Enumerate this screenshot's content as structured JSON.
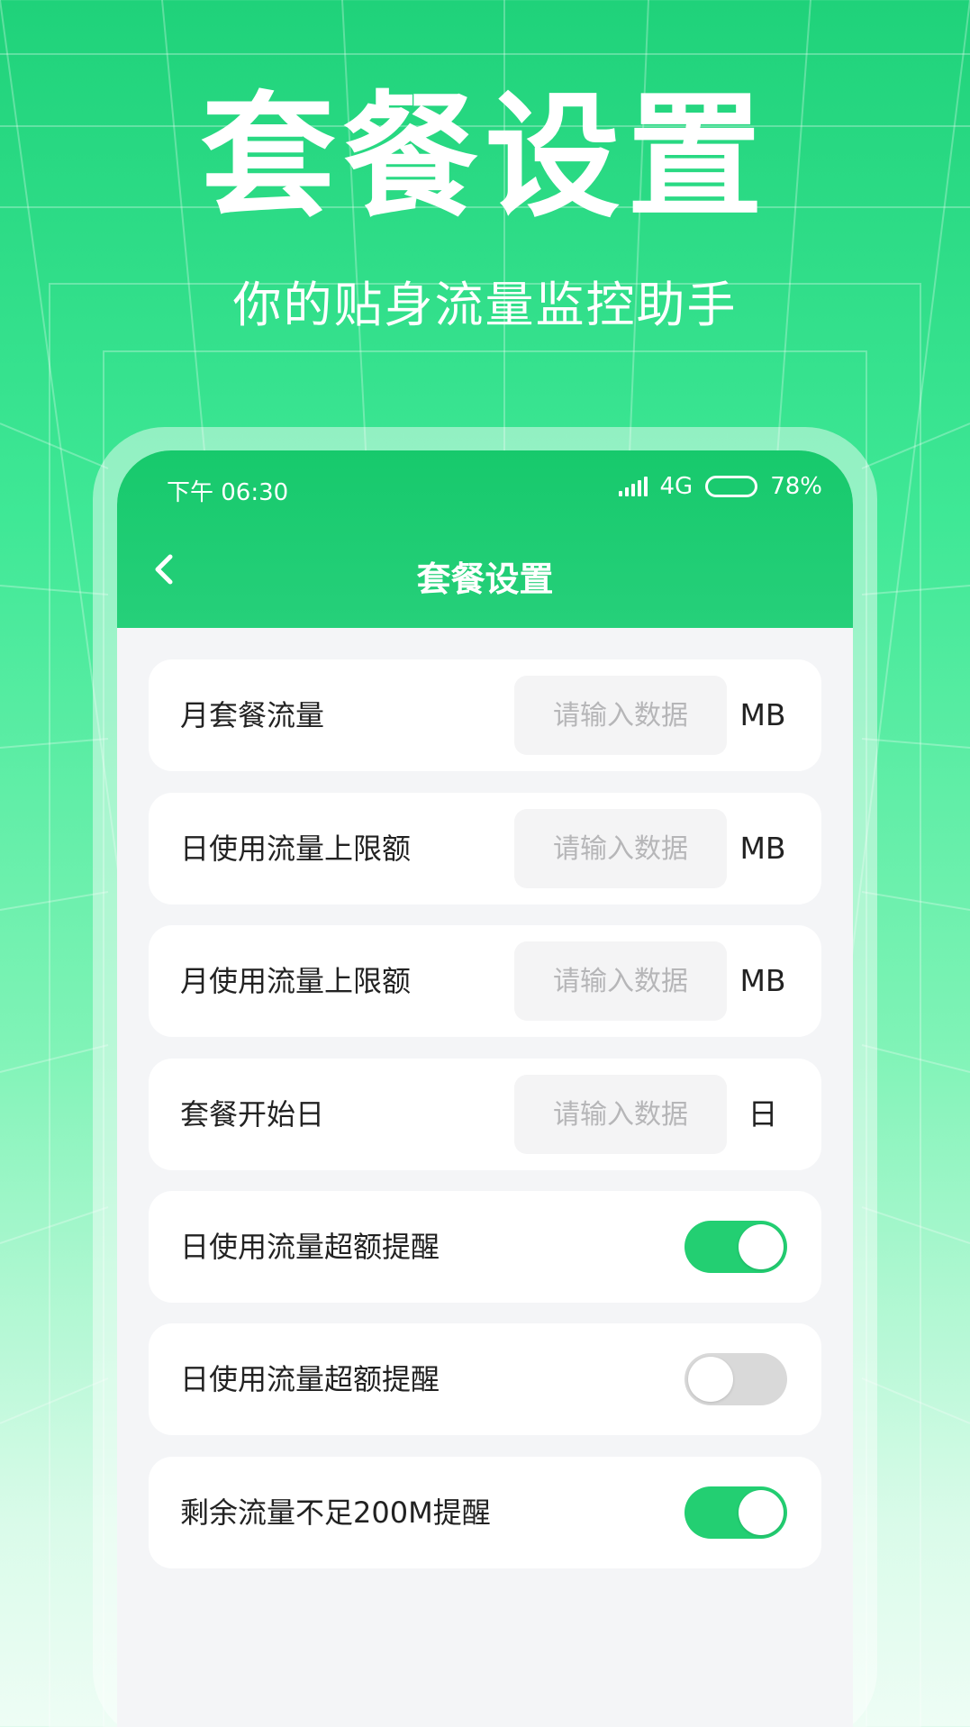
{
  "promo": {
    "title": "套餐设置",
    "subtitle": "你的贴身流量监控助手"
  },
  "status_bar": {
    "time": "下午 06:30",
    "network": "4G",
    "battery": "78%",
    "battery_level": 0.78
  },
  "nav": {
    "back_icon": "chevron-left-icon",
    "title": "套餐设置"
  },
  "settings": {
    "inputs": [
      {
        "label": "月套餐流量",
        "placeholder": "请输入数据",
        "unit": "MB"
      },
      {
        "label": "日使用流量上限额",
        "placeholder": "请输入数据",
        "unit": "MB"
      },
      {
        "label": "月使用流量上限额",
        "placeholder": "请输入数据",
        "unit": "MB"
      },
      {
        "label": "套餐开始日",
        "placeholder": "请输入数据",
        "unit": "日"
      }
    ],
    "toggles": [
      {
        "label": "日使用流量超额提醒",
        "on": true
      },
      {
        "label": "日使用流量超额提醒",
        "on": false
      },
      {
        "label": "剩余流量不足200M提醒",
        "on": true
      }
    ]
  },
  "colors": {
    "accent": "#23cf72",
    "header": "#17c96c",
    "toggle_off": "#d9d9d9",
    "screen_bg": "#f4f5f7"
  }
}
